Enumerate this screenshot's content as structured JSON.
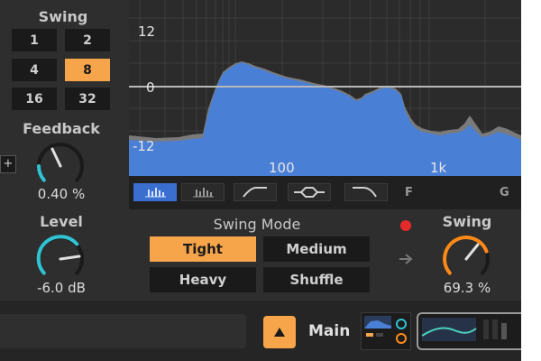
{
  "swing_section": {
    "title": "Swing",
    "buttons": [
      "1",
      "2",
      "4",
      "8",
      "16",
      "32"
    ],
    "selected": "8"
  },
  "feedback": {
    "label": "Feedback",
    "value": "0.40 %"
  },
  "level": {
    "label": "Level",
    "value": "-6.0 dB"
  },
  "spectrum": {
    "db_labels": [
      "12",
      "0",
      "-12"
    ],
    "freq_labels": [
      "100",
      "1k"
    ],
    "filter_extra_labels": [
      "F",
      "G"
    ]
  },
  "swing_mode": {
    "title": "Swing Mode",
    "options": [
      "Tight",
      "Medium",
      "Heavy",
      "Shuffle"
    ],
    "selected": "Tight"
  },
  "swing_knob": {
    "label": "Swing",
    "value": "69.3 %"
  },
  "bottom_bar": {
    "chain_label": "Main"
  },
  "colors": {
    "accent": "#f7a54a",
    "teal": "#2fc3d4",
    "orange": "#ff8a18",
    "spectrum_fill": "#4a7fd6",
    "record_dot": "#e62a2a"
  }
}
